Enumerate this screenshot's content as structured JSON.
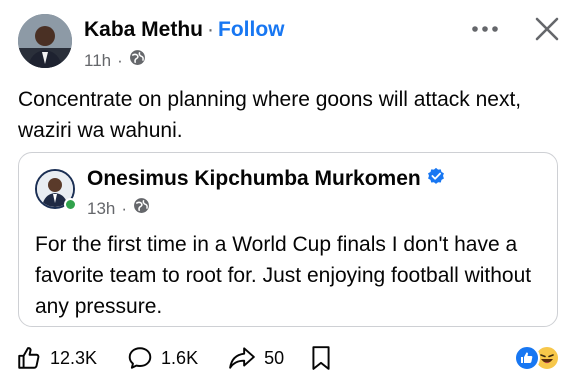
{
  "post": {
    "author": "Kaba Methu",
    "separator": "·",
    "follow_label": "Follow",
    "time": "11h",
    "time_separator": "·",
    "audience_icon": "globe-icon",
    "text": "Concentrate on planning where goons will attack next, waziri wa wahuni."
  },
  "shared_post": {
    "author": "Onesimus Kipchumba Murkomen",
    "verified_icon": "verified-badge-icon",
    "time": "13h",
    "time_separator": "·",
    "audience_icon": "globe-icon",
    "text": "For the first time in a World Cup finals I don't have a favorite team to root for. Just enjoying football without any pressure."
  },
  "actions": {
    "likes": "12.3K",
    "comments": "1.6K",
    "shares": "50"
  },
  "colors": {
    "accent": "#1877f2",
    "secondary_text": "#65676b",
    "online": "#31a24c",
    "haha": "#f7c74a"
  }
}
